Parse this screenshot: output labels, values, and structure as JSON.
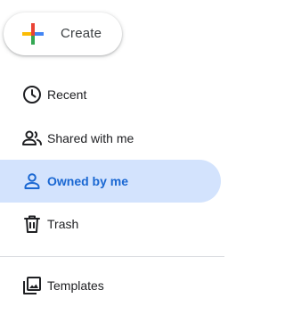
{
  "create": {
    "label": "Create"
  },
  "nav": {
    "items": [
      {
        "label": "Recent",
        "icon": "clock-icon"
      },
      {
        "label": "Shared with me",
        "icon": "people-icon"
      },
      {
        "label": "Owned by me",
        "icon": "person-icon",
        "active": true
      },
      {
        "label": "Trash",
        "icon": "trash-icon"
      }
    ],
    "secondary": [
      {
        "label": "Templates",
        "icon": "templates-icon"
      }
    ]
  },
  "colors": {
    "active_bg": "#d3e3fd",
    "active_text": "#1967d2",
    "text": "#202124",
    "plus_blue": "#4285f4",
    "plus_red": "#ea4335",
    "plus_yellow": "#fbbc04",
    "plus_green": "#34a853"
  }
}
